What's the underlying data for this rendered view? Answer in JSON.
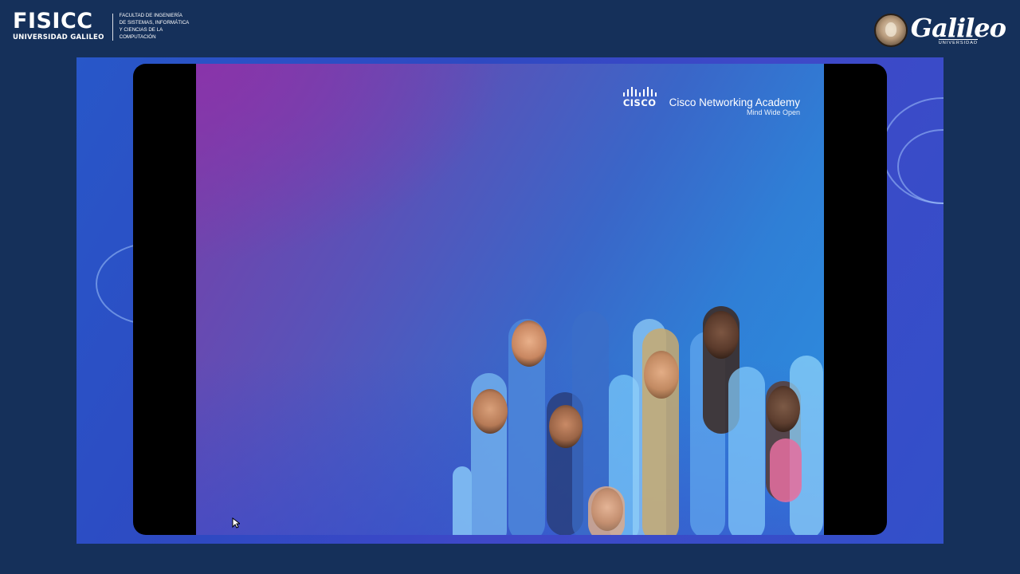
{
  "header": {
    "logo_main": "FISICC",
    "logo_sub": "UNIVERSIDAD GALILEO",
    "faculty_lines": [
      "FACULTAD DE INGENIERÍA",
      "DE SISTEMAS, INFORMÁTICA",
      "Y CIENCIAS DE LA",
      "COMPUTACIÓN"
    ],
    "university_name": "Galileo",
    "university_sub": "UNIVERSIDAD"
  },
  "slide": {
    "cisco_wordmark": "CISCO",
    "brand_title": "Cisco Networking Academy",
    "brand_tagline": "Mind Wide Open"
  },
  "colors": {
    "page_bg": "#15305a",
    "slide_purple": "#7a3ea8",
    "slide_blue": "#2d8fe0"
  },
  "icons": {
    "cursor": "mouse-pointer-icon",
    "seal": "galileo-seal-icon"
  }
}
